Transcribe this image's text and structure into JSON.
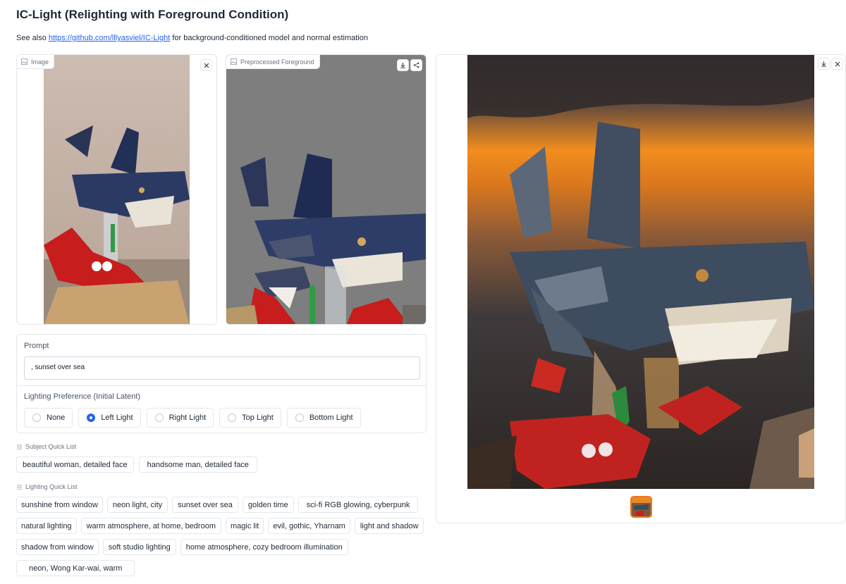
{
  "header": {
    "title": "IC-Light (Relighting with Foreground Condition)",
    "subtitle_prefix": "See also",
    "subtitle_link": "https://github.com/lllyasviel/IC-Light",
    "subtitle_suffix": "for background-conditioned model and normal estimation"
  },
  "input_image": {
    "label": "Image",
    "image_icon": "image-icon",
    "clear_icon": "close-icon"
  },
  "preprocessed": {
    "label": "Preprocessed Foreground",
    "image_icon": "image-icon",
    "download_icon": "download-icon",
    "share_icon": "share-icon"
  },
  "output": {
    "download_icon": "download-icon",
    "clear_icon": "close-icon"
  },
  "prompt": {
    "label": "Prompt",
    "value": ", sunset over sea"
  },
  "lighting": {
    "label": "Lighting Preference (Initial Latent)",
    "options": [
      "None",
      "Left Light",
      "Right Light",
      "Top Light",
      "Bottom Light"
    ],
    "selected": "Left Light"
  },
  "subject_quick_list": {
    "label": "Subject Quick List",
    "items": [
      "beautiful woman, detailed face",
      "handsome man, detailed face"
    ]
  },
  "lighting_quick_list": {
    "label": "Lighting Quick List",
    "items": [
      "sunshine from window",
      "neon light, city",
      "sunset over sea",
      "golden time",
      "sci-fi RGB glowing, cyberpunk",
      "natural lighting",
      "warm atmosphere, at home, bedroom",
      "magic lit",
      "evil, gothic, Yharnam",
      "light and shadow",
      "shadow from window",
      "soft studio lighting",
      "home atmosphere, cozy bedroom illumination",
      "neon, Wong Kar-wai, warm"
    ]
  },
  "colors": {
    "accent": "#2563eb",
    "link": "#2563eb",
    "thumb_border": "#f97316",
    "border": "#e5e7eb"
  }
}
